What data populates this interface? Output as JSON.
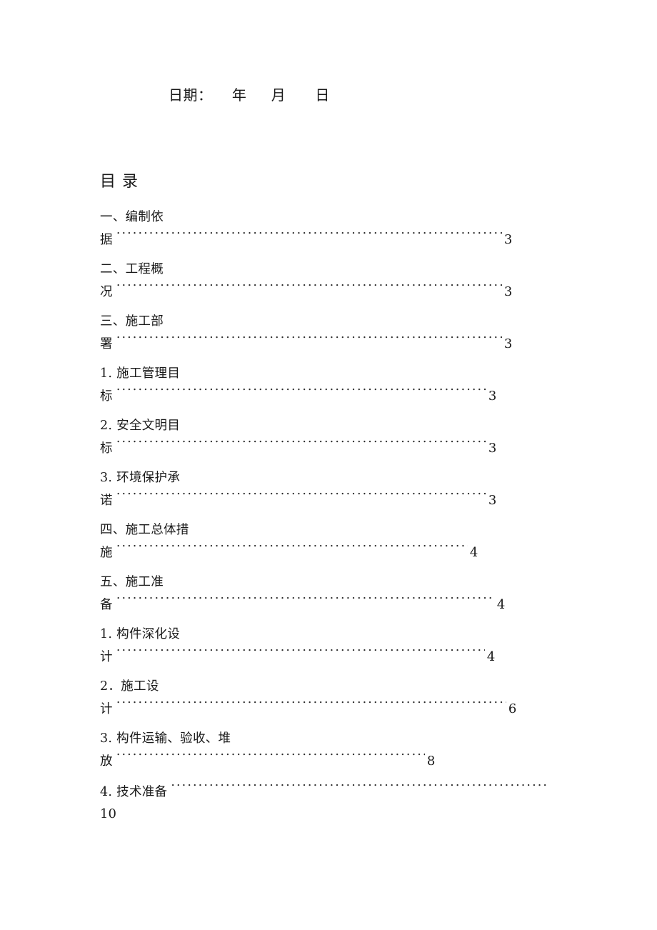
{
  "document": {
    "date_line": "日期：    年     月      日",
    "toc_heading": "目 录"
  },
  "toc": {
    "entries": [
      {
        "title_line": "一、编制依",
        "tail": "据",
        "page": "3",
        "dots_width": 540
      },
      {
        "title_line": "二、工程概",
        "tail": "况",
        "page": "3",
        "dots_width": 540
      },
      {
        "title_line": "三、施工部",
        "tail": "署",
        "page": "3",
        "dots_width": 540
      },
      {
        "title_line": "1. 施工管理目",
        "tail": "标",
        "page": "3",
        "dots_width": 518
      },
      {
        "title_line": "2. 安全文明目",
        "tail": "标",
        "page": "3",
        "dots_width": 518
      },
      {
        "title_line": "3. 环境保护承",
        "tail": "诺",
        "page": "3",
        "dots_width": 518
      },
      {
        "title_line": "四、施工总体措",
        "tail": "施",
        "page": "4",
        "dots_width": 492
      },
      {
        "title_line": "五、施工准",
        "tail": "备",
        "page": "4",
        "dots_width": 530
      },
      {
        "title_line": "1. 构件深化设",
        "tail": "计",
        "page": "4",
        "dots_width": 516
      },
      {
        "title_line": "2．施工设",
        "tail": "计",
        "page": "6",
        "dots_width": 546
      },
      {
        "title_line": "3. 构件运输、验收、堆",
        "tail": "放",
        "page": "8",
        "dots_width": 432
      },
      {
        "title_line": "",
        "tail": "4. 技术准备",
        "page": "10",
        "dots_width": 528,
        "page_wraps": true
      }
    ]
  }
}
